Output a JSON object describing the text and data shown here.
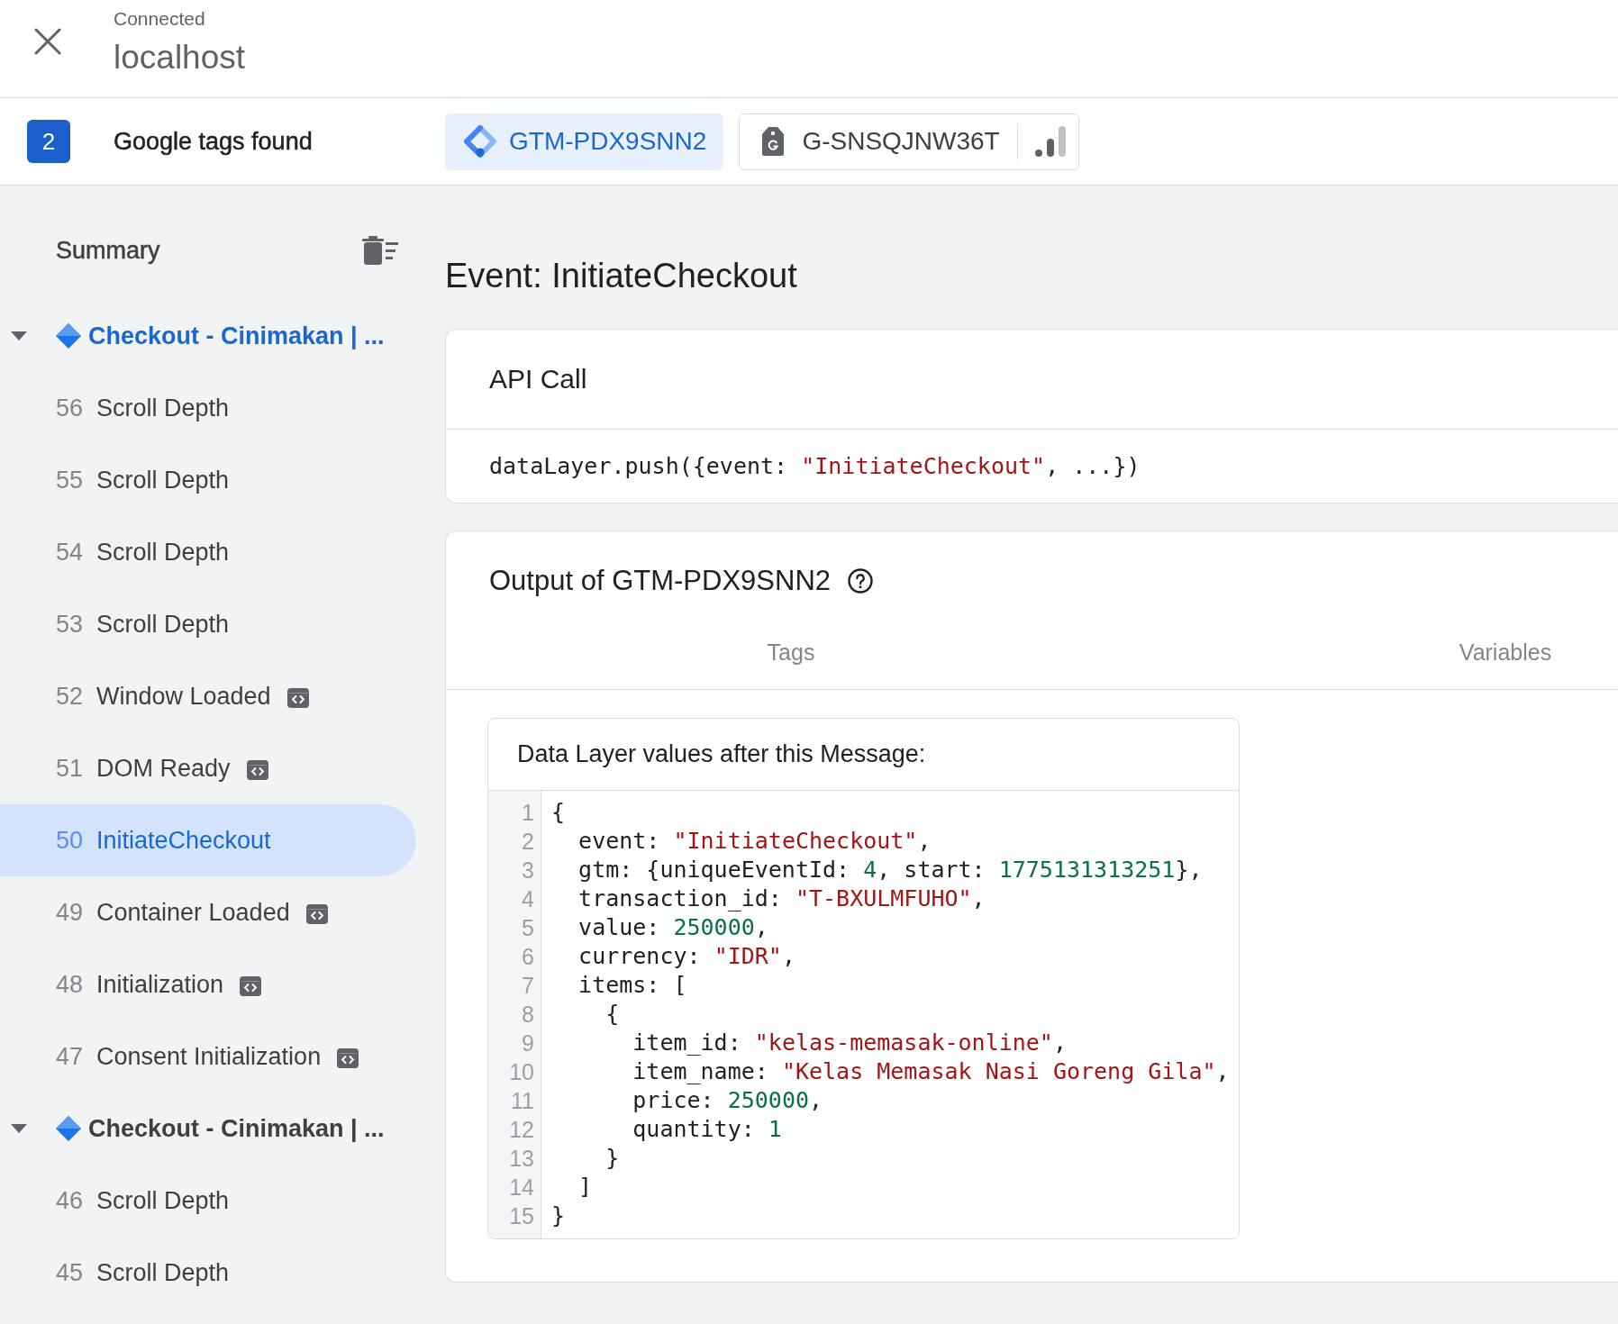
{
  "header": {
    "status": "Connected",
    "host": "localhost"
  },
  "tag_bar": {
    "count": "2",
    "label": "Google tags found",
    "tags": [
      {
        "kind": "gtm",
        "id": "GTM-PDX9SNN2",
        "selected": true
      },
      {
        "kind": "ga",
        "id": "G-SNSQJNW36T",
        "selected": false
      }
    ]
  },
  "sidebar": {
    "summary": "Summary",
    "groups": [
      {
        "title": "Checkout - Cinimakan | ...",
        "selected": true,
        "expanded": true,
        "children": [
          {
            "number": "56",
            "label": "Scroll Depth",
            "badge": false,
            "selected": false
          },
          {
            "number": "55",
            "label": "Scroll Depth",
            "badge": false,
            "selected": false
          },
          {
            "number": "54",
            "label": "Scroll Depth",
            "badge": false,
            "selected": false
          },
          {
            "number": "53",
            "label": "Scroll Depth",
            "badge": false,
            "selected": false
          },
          {
            "number": "52",
            "label": "Window Loaded",
            "badge": true,
            "selected": false
          },
          {
            "number": "51",
            "label": "DOM Ready",
            "badge": true,
            "selected": false
          },
          {
            "number": "50",
            "label": "InitiateCheckout",
            "badge": false,
            "selected": true
          },
          {
            "number": "49",
            "label": "Container Loaded",
            "badge": true,
            "selected": false
          },
          {
            "number": "48",
            "label": "Initialization",
            "badge": true,
            "selected": false
          },
          {
            "number": "47",
            "label": "Consent Initialization",
            "badge": true,
            "selected": false
          }
        ]
      },
      {
        "title": "Checkout - Cinimakan | ...",
        "selected": false,
        "expanded": true,
        "children": [
          {
            "number": "46",
            "label": "Scroll Depth",
            "badge": false,
            "selected": false
          },
          {
            "number": "45",
            "label": "Scroll Depth",
            "badge": false,
            "selected": false
          }
        ]
      }
    ]
  },
  "event": {
    "title": "Event: InitiateCheckout",
    "api_call": {
      "title": "API Call",
      "code": [
        {
          "kind": "plain",
          "text": "dataLayer.push({event: "
        },
        {
          "kind": "string",
          "text": "\"InitiateCheckout\""
        },
        {
          "kind": "plain",
          "text": ", ...})"
        }
      ]
    },
    "output": {
      "title": "Output of GTM-PDX9SNN2",
      "tabs": [
        {
          "label": "Tags",
          "selected": false
        },
        {
          "label": "Variables",
          "selected": false
        }
      ],
      "data_layer": {
        "title": "Data Layer values after this Message:",
        "lines": [
          {
            "number": "1",
            "tokens": [
              {
                "kind": "plain",
                "text": "{"
              }
            ]
          },
          {
            "number": "2",
            "tokens": [
              {
                "kind": "plain",
                "text": "  event: "
              },
              {
                "kind": "string",
                "text": "\"InitiateCheckout\""
              },
              {
                "kind": "plain",
                "text": ","
              }
            ]
          },
          {
            "number": "3",
            "tokens": [
              {
                "kind": "plain",
                "text": "  gtm: {uniqueEventId: "
              },
              {
                "kind": "number",
                "text": "4"
              },
              {
                "kind": "plain",
                "text": ", start: "
              },
              {
                "kind": "number",
                "text": "1775131313251"
              },
              {
                "kind": "plain",
                "text": "},"
              }
            ]
          },
          {
            "number": "4",
            "tokens": [
              {
                "kind": "plain",
                "text": "  transaction_id: "
              },
              {
                "kind": "string",
                "text": "\"T-BXULMFUHO\""
              },
              {
                "kind": "plain",
                "text": ","
              }
            ]
          },
          {
            "number": "5",
            "tokens": [
              {
                "kind": "plain",
                "text": "  value: "
              },
              {
                "kind": "number",
                "text": "250000"
              },
              {
                "kind": "plain",
                "text": ","
              }
            ]
          },
          {
            "number": "6",
            "tokens": [
              {
                "kind": "plain",
                "text": "  currency: "
              },
              {
                "kind": "string",
                "text": "\"IDR\""
              },
              {
                "kind": "plain",
                "text": ","
              }
            ]
          },
          {
            "number": "7",
            "tokens": [
              {
                "kind": "plain",
                "text": "  items: ["
              }
            ]
          },
          {
            "number": "8",
            "tokens": [
              {
                "kind": "plain",
                "text": "    {"
              }
            ]
          },
          {
            "number": "9",
            "tokens": [
              {
                "kind": "plain",
                "text": "      item_id: "
              },
              {
                "kind": "string",
                "text": "\"kelas-memasak-online\""
              },
              {
                "kind": "plain",
                "text": ","
              }
            ]
          },
          {
            "number": "10",
            "tokens": [
              {
                "kind": "plain",
                "text": "      item_name: "
              },
              {
                "kind": "string",
                "text": "\"Kelas Memasak Nasi Goreng Gila\""
              },
              {
                "kind": "plain",
                "text": ","
              }
            ]
          },
          {
            "number": "11",
            "tokens": [
              {
                "kind": "plain",
                "text": "      price: "
              },
              {
                "kind": "number",
                "text": "250000"
              },
              {
                "kind": "plain",
                "text": ","
              }
            ]
          },
          {
            "number": "12",
            "tokens": [
              {
                "kind": "plain",
                "text": "      quantity: "
              },
              {
                "kind": "number",
                "text": "1"
              }
            ]
          },
          {
            "number": "13",
            "tokens": [
              {
                "kind": "plain",
                "text": "    }"
              }
            ]
          },
          {
            "number": "14",
            "tokens": [
              {
                "kind": "plain",
                "text": "  ]"
              }
            ]
          },
          {
            "number": "15",
            "tokens": [
              {
                "kind": "plain",
                "text": "}"
              }
            ]
          }
        ]
      }
    }
  }
}
